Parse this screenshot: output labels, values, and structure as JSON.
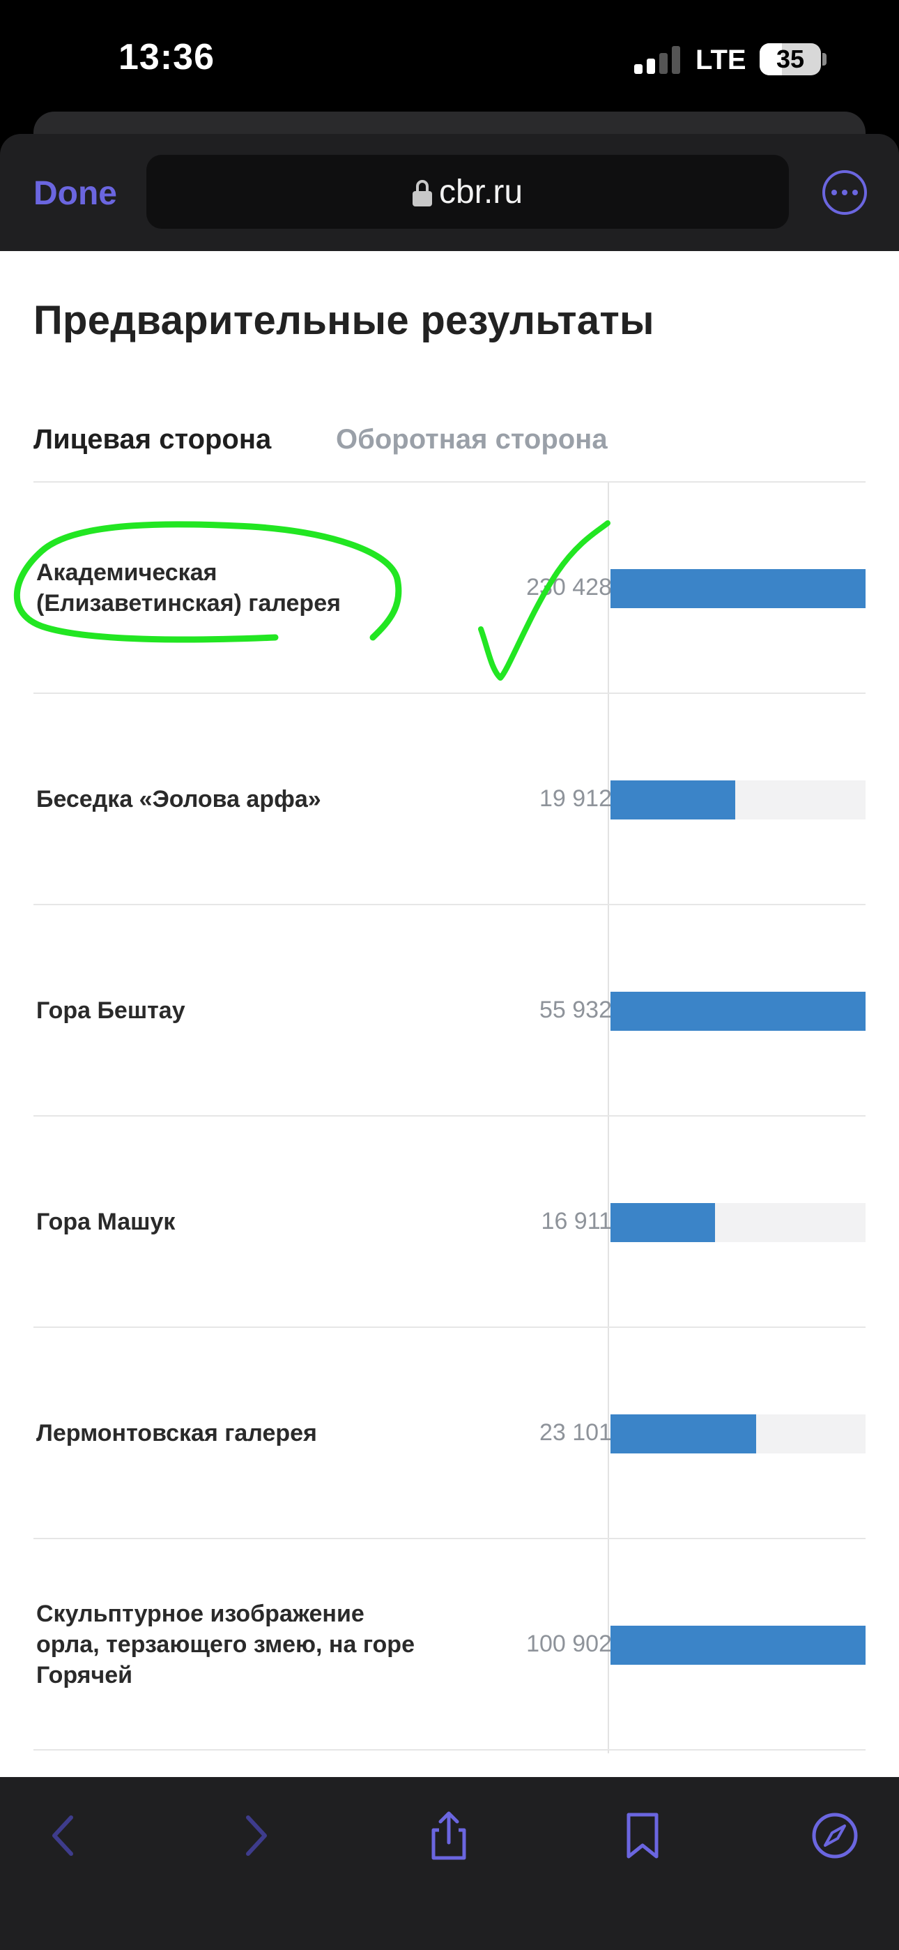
{
  "status": {
    "time": "13:36",
    "network": "LTE",
    "battery": "35"
  },
  "browser": {
    "done_label": "Done",
    "url": "cbr.ru"
  },
  "page": {
    "title": "Предварительные результаты",
    "tabs": [
      {
        "label": "Лицевая сторона",
        "active": true
      },
      {
        "label": "Оборотная сторона",
        "active": false
      }
    ],
    "rows": [
      {
        "label": "Академическая (Елизаветинская) галерея",
        "value": "230 428",
        "fill": 1.0
      },
      {
        "label": "Беседка «Эолова арфа»",
        "value": "19 912",
        "fill": 0.49
      },
      {
        "label": "Гора Бештау",
        "value": "55 932",
        "fill": 1.0
      },
      {
        "label": "Гора Машук",
        "value": "16 911",
        "fill": 0.41
      },
      {
        "label": "Лермонтовская галерея",
        "value": "23 101",
        "fill": 0.57
      },
      {
        "label": "Скульптурное изображение орла, терзающего змею, на горе Горячей",
        "value": "100 902",
        "fill": 1.0
      }
    ]
  },
  "colors": {
    "accent": "#6b66e0",
    "bar": "#3b84c8",
    "annotation": "#22e622"
  },
  "icons": [
    "lock-icon",
    "more-icon",
    "back-arrow-icon",
    "forward-arrow-icon",
    "share-icon",
    "bookmarks-icon",
    "compass-icon"
  ]
}
